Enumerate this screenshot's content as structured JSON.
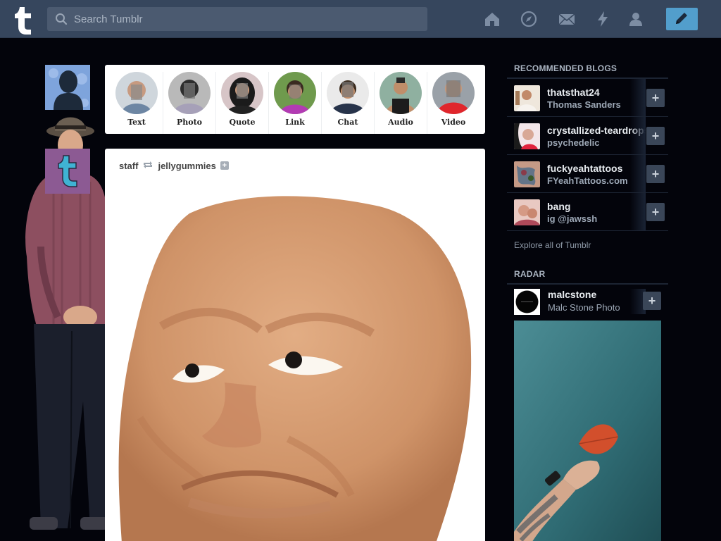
{
  "header": {
    "search_placeholder": "Search Tumblr",
    "nav_icons": [
      "home-icon",
      "explore-compass-icon",
      "inbox-mail-icon",
      "activity-lightning-icon",
      "account-person-icon"
    ],
    "compose_icon": "pencil-icon",
    "accent": "#529ecc",
    "bar_color": "#36465d"
  },
  "post_types": [
    {
      "label": "Text"
    },
    {
      "label": "Photo"
    },
    {
      "label": "Quote"
    },
    {
      "label": "Link"
    },
    {
      "label": "Chat"
    },
    {
      "label": "Audio"
    },
    {
      "label": "Video"
    }
  ],
  "post": {
    "author": "staff",
    "reblogged_from": "jellygummies"
  },
  "sidebar": {
    "recommended_title": "RECOMMENDED BLOGS",
    "blogs": [
      {
        "name": "thatsthat24",
        "sub": "Thomas Sanders"
      },
      {
        "name": "crystallized-teardrops",
        "sub": "psychedelic"
      },
      {
        "name": "fuckyeahtattoos",
        "sub": "FYeahTattoos.com"
      },
      {
        "name": "bang",
        "sub": "ig @jawssh"
      }
    ],
    "explore_link": "Explore all of Tumblr",
    "radar_title": "RADAR",
    "radar": {
      "name": "malcstone",
      "sub": "Malc Stone Photo"
    }
  }
}
